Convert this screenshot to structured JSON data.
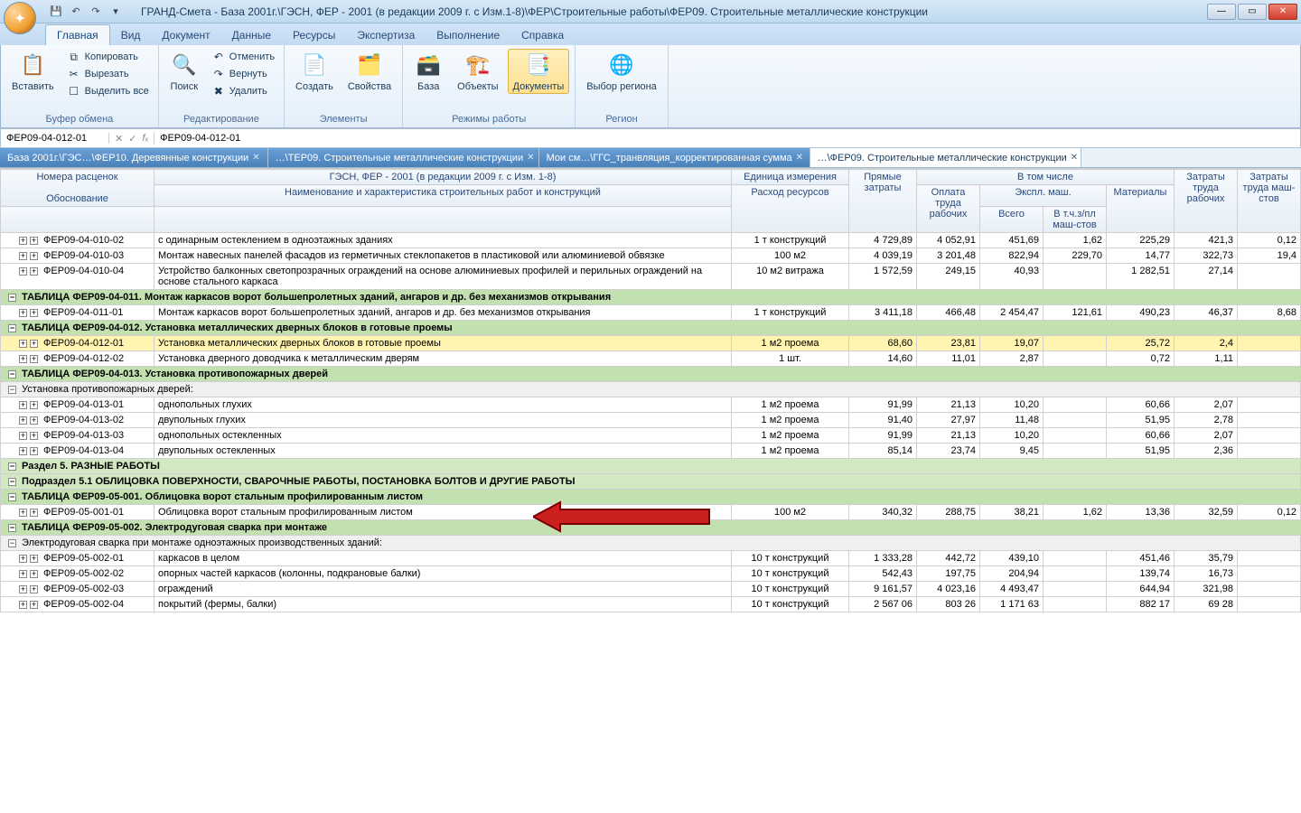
{
  "title": "ГРАНД-Смета - База 2001г.\\ГЭСН, ФЕР - 2001 (в редакции 2009 г. с Изм.1-8)\\ФЕР\\Строительные работы\\ФЕР09. Строительные металлические конструкции",
  "ribbon": {
    "tabs": [
      "Главная",
      "Вид",
      "Документ",
      "Данные",
      "Ресурсы",
      "Экспертиза",
      "Выполнение",
      "Справка"
    ],
    "active_tab": 0,
    "groups": {
      "buffer": {
        "label": "Буфер обмена",
        "paste": "Вставить",
        "copy": "Копировать",
        "cut": "Вырезать",
        "select_all": "Выделить все"
      },
      "edit": {
        "label": "Редактирование",
        "search": "Поиск",
        "undo": "Отменить",
        "redo": "Вернуть",
        "delete": "Удалить"
      },
      "elements": {
        "label": "Элементы",
        "create": "Создать",
        "props": "Свойства"
      },
      "modes": {
        "label": "Режимы работы",
        "base": "База",
        "objects": "Объекты",
        "docs": "Документы"
      },
      "region": {
        "label": "Регион",
        "pick": "Выбор региона"
      }
    }
  },
  "formula": {
    "ref": "ФЕР09-04-012-01",
    "val": "ФЕР09-04-012-01"
  },
  "doc_tabs": [
    {
      "label": "База 2001г.\\ГЭС…\\ФЕР10. Деревянные конструкции",
      "cls": "blue"
    },
    {
      "label": "…\\ТЕР09. Строительные металлические конструкции",
      "cls": "blue"
    },
    {
      "label": "Мои см…\\ГГС_транвляция_корректированная сумма",
      "cls": "blue"
    },
    {
      "label": "…\\ФЕР09. Строительные металлические конструкции",
      "cls": "active"
    }
  ],
  "headers": {
    "code": "Номера расценок",
    "name_top": "ГЭСН, ФЕР - 2001 (в редакции 2009 г. с Изм. 1-8)",
    "unit": "Единица измерения",
    "direct": "Прямые затраты",
    "including": "В том числе",
    "labor_workers": "Затраты труда рабочих",
    "labor_machines": "Затраты труда маш-стов",
    "basis": "Обоснование",
    "name": "Наименование и характеристика строительных работ и конструкций",
    "consumption": "Расход ресурсов",
    "wages": "Оплата труда рабочих",
    "expl": "Экспл. маш.",
    "materials": "Материалы",
    "total": "Всего",
    "incl_wages": "В т.ч.з/пл маш-стов"
  },
  "rows": [
    {
      "type": "data",
      "code": "ФЕР09-04-010-02",
      "name": "с одинарным остеклением в одноэтажных зданиях",
      "unit": "1 т конструкций",
      "v": [
        "4 729,89",
        "4 052,91",
        "451,69",
        "1,62",
        "225,29",
        "421,3",
        "0,12"
      ]
    },
    {
      "type": "data",
      "code": "ФЕР09-04-010-03",
      "name": "Монтаж навесных панелей фасадов из герметичных стеклопакетов в пластиковой или алюминиевой обвязке",
      "unit": "100 м2",
      "v": [
        "4 039,19",
        "3 201,48",
        "822,94",
        "229,70",
        "14,77",
        "322,73",
        "19,4"
      ]
    },
    {
      "type": "data",
      "code": "ФЕР09-04-010-04",
      "name": "Устройство балконных светопрозрачных ограждений на основе алюминиевых профилей и перильных ограждений на основе стального каркаса",
      "unit": "10 м2 витража",
      "v": [
        "1 572,59",
        "249,15",
        "40,93",
        "",
        "1 282,51",
        "27,14",
        ""
      ]
    },
    {
      "type": "table",
      "code": "ТАБЛИЦА ФЕР09-04-011.",
      "name": "Монтаж каркасов ворот большепролетных зданий, ангаров и др. без механизмов открывания"
    },
    {
      "type": "data",
      "code": "ФЕР09-04-011-01",
      "name": "Монтаж каркасов ворот большепролетных зданий, ангаров и др. без механизмов открывания",
      "unit": "1 т конструкций",
      "v": [
        "3 411,18",
        "466,48",
        "2 454,47",
        "121,61",
        "490,23",
        "46,37",
        "8,68"
      ]
    },
    {
      "type": "table",
      "code": "ТАБЛИЦА ФЕР09-04-012.",
      "name": "Установка металлических дверных блоков в готовые проемы"
    },
    {
      "type": "data",
      "selected": true,
      "code": "ФЕР09-04-012-01",
      "name": "Установка металлических дверных блоков в готовые проемы",
      "unit": "1 м2 проема",
      "v": [
        "68,60",
        "23,81",
        "19,07",
        "",
        "25,72",
        "2,4",
        ""
      ]
    },
    {
      "type": "data",
      "code": "ФЕР09-04-012-02",
      "name": "Установка дверного доводчика к металлическим дверям",
      "unit": "1 шт.",
      "v": [
        "14,60",
        "11,01",
        "2,87",
        "",
        "0,72",
        "1,11",
        ""
      ]
    },
    {
      "type": "table",
      "code": "ТАБЛИЦА ФЕР09-04-013.",
      "name": "Установка противопожарных дверей"
    },
    {
      "type": "sub",
      "name": "Установка противопожарных дверей:"
    },
    {
      "type": "data",
      "code": "ФЕР09-04-013-01",
      "name": "однопольных глухих",
      "unit": "1 м2 проема",
      "v": [
        "91,99",
        "21,13",
        "10,20",
        "",
        "60,66",
        "2,07",
        ""
      ]
    },
    {
      "type": "data",
      "code": "ФЕР09-04-013-02",
      "name": "двупольных глухих",
      "unit": "1 м2 проема",
      "v": [
        "91,40",
        "27,97",
        "11,48",
        "",
        "51,95",
        "2,78",
        ""
      ]
    },
    {
      "type": "data",
      "code": "ФЕР09-04-013-03",
      "name": "однопольных остекленных",
      "unit": "1 м2 проема",
      "v": [
        "91,99",
        "21,13",
        "10,20",
        "",
        "60,66",
        "2,07",
        ""
      ]
    },
    {
      "type": "data",
      "code": "ФЕР09-04-013-04",
      "name": "двупольных остекленных",
      "unit": "1 м2 проема",
      "v": [
        "85,14",
        "23,74",
        "9,45",
        "",
        "51,95",
        "2,36",
        ""
      ]
    },
    {
      "type": "section",
      "name": "Раздел 5. РАЗНЫЕ РАБОТЫ"
    },
    {
      "type": "section",
      "name": "Подраздел 5.1 ОБЛИЦОВКА ПОВЕРХНОСТИ, СВАРОЧНЫЕ РАБОТЫ, ПОСТАНОВКА БОЛТОВ И ДРУГИЕ РАБОТЫ"
    },
    {
      "type": "table",
      "code": "ТАБЛИЦА ФЕР09-05-001.",
      "name": "Облицовка ворот стальным профилированным листом"
    },
    {
      "type": "data",
      "code": "ФЕР09-05-001-01",
      "name": "Облицовка ворот стальным профилированным листом",
      "unit": "100 м2",
      "v": [
        "340,32",
        "288,75",
        "38,21",
        "1,62",
        "13,36",
        "32,59",
        "0,12"
      ]
    },
    {
      "type": "table",
      "code": "ТАБЛИЦА ФЕР09-05-002.",
      "name": "Электродуговая сварка при монтаже"
    },
    {
      "type": "sub",
      "name": "Электродуговая сварка при монтаже одноэтажных производственных зданий:"
    },
    {
      "type": "data",
      "code": "ФЕР09-05-002-01",
      "name": "каркасов в целом",
      "unit": "10 т конструкций",
      "v": [
        "1 333,28",
        "442,72",
        "439,10",
        "",
        "451,46",
        "35,79",
        ""
      ]
    },
    {
      "type": "data",
      "code": "ФЕР09-05-002-02",
      "name": "опорных частей каркасов (колонны, подкрановые балки)",
      "unit": "10 т конструкций",
      "v": [
        "542,43",
        "197,75",
        "204,94",
        "",
        "139,74",
        "16,73",
        ""
      ]
    },
    {
      "type": "data",
      "code": "ФЕР09-05-002-03",
      "name": "ограждений",
      "unit": "10 т конструкций",
      "v": [
        "9 161,57",
        "4 023,16",
        "4 493,47",
        "",
        "644,94",
        "321,98",
        ""
      ]
    },
    {
      "type": "data",
      "code": "ФЕР09-05-002-04",
      "name": "покрытий (фермы, балки)",
      "unit": "10 т конструкций",
      "v": [
        "2 567 06",
        "803 26",
        "1 171 63",
        "",
        "882 17",
        "69 28",
        ""
      ]
    }
  ]
}
